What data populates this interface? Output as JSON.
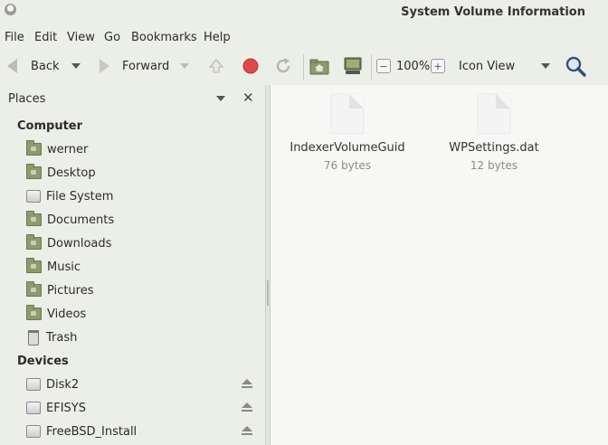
{
  "window": {
    "title": "System Volume Information"
  },
  "menu": {
    "items": [
      "File",
      "Edit",
      "View",
      "Go",
      "Bookmarks",
      "Help"
    ]
  },
  "toolbar": {
    "back_label": "Back",
    "forward_label": "Forward",
    "zoom_level": "100%",
    "view_mode": "Icon View"
  },
  "sidebar": {
    "header": "Places",
    "computer_section": "Computer",
    "computer_items": [
      "werner",
      "Desktop",
      "File System",
      "Documents",
      "Downloads",
      "Music",
      "Pictures",
      "Videos",
      "Trash"
    ],
    "devices_section": "Devices",
    "device_items": [
      "Disk2",
      "EFISYS",
      "FreeBSD_Install"
    ]
  },
  "files": [
    {
      "name": "IndexerVolumeGuid",
      "size": "76 bytes"
    },
    {
      "name": "WPSettings.dat",
      "size": "12 bytes"
    }
  ]
}
